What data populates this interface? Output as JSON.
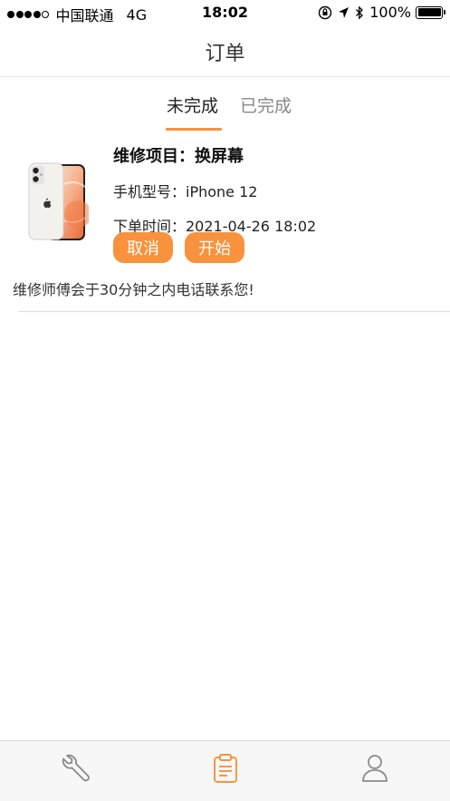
{
  "status_bar": {
    "carrier": "中国联通",
    "network": "4G",
    "time": "18:02",
    "battery_percent": "100%",
    "battery_level": 1.0
  },
  "nav": {
    "title": "订单"
  },
  "tabs": [
    {
      "label": "未完成",
      "active": true
    },
    {
      "label": "已完成",
      "active": false
    }
  ],
  "order": {
    "title": "维修项目：换屏幕",
    "model_line": "手机型号：iPhone 12",
    "time_line": "下单时间：2021-04-26 18:02",
    "cancel_label": "取消",
    "start_label": "开始",
    "image_icon": "white-iphone-12"
  },
  "notice": "维修师傅会于30分钟之内电话联系您!",
  "tab_bar": {
    "items": [
      {
        "icon": "wrench-icon",
        "active": false
      },
      {
        "icon": "clipboard-icon",
        "active": true
      },
      {
        "icon": "user-icon",
        "active": false
      }
    ]
  },
  "colors": {
    "accent": "#f8923c",
    "tab_inactive": "#888888",
    "tab_icon_inactive": "#8a8a8a"
  }
}
